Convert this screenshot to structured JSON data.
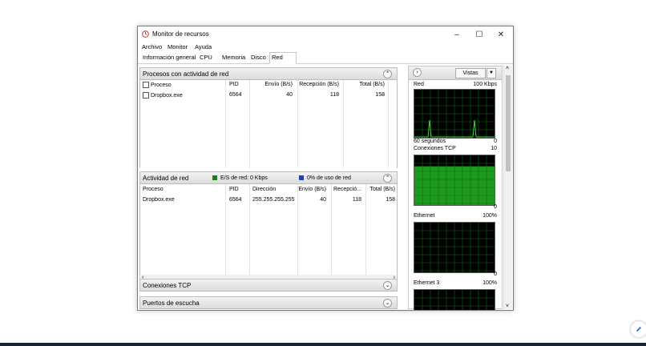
{
  "window": {
    "title": "Monitor de recursos",
    "controls": {
      "minimize": "–",
      "maximize": "☐",
      "close": "✕"
    }
  },
  "menu": [
    "Archivo",
    "Monitor",
    "Ayuda"
  ],
  "tabs": [
    "Información general",
    "CPU",
    "Memoria",
    "Disco",
    "Red"
  ],
  "active_tab": "Red",
  "sections": {
    "procesos": {
      "title": "Procesos con actividad de red",
      "columns": [
        "Proceso",
        "PID",
        "Envío (B/s)",
        "Recepción (B/s)",
        "Total (B/s)"
      ],
      "rows": [
        [
          "Dropbox.exe",
          "6564",
          "40",
          "118",
          "158"
        ]
      ]
    },
    "actividad": {
      "title": "Actividad de red",
      "legend_io": "E/S de red: 0 Kbps",
      "legend_usage": "0% de uso de red",
      "columns": [
        "Proceso",
        "PID",
        "Dirección",
        "Envío (B/s)",
        "Recepció...",
        "Total (B/s)"
      ],
      "rows": [
        [
          "Dropbox.exe",
          "6564",
          "255.255.255.255",
          "40",
          "118",
          "158"
        ]
      ]
    },
    "tcp": {
      "title": "Conexiones TCP"
    },
    "puertos": {
      "title": "Puertos de escucha"
    }
  },
  "right": {
    "views_label": "Vistas",
    "graphs": {
      "red": {
        "title": "Red",
        "max": "100 Kbps",
        "time": "60 segundos",
        "min": "0"
      },
      "tcp": {
        "title": "Conexiones TCP",
        "max": "10",
        "min": "0",
        "level": 0.78
      },
      "ethernet": {
        "title": "Ethernet",
        "max": "100%",
        "min": "0"
      },
      "ethernet3": {
        "title": "Ethernet 3",
        "max": "100%"
      }
    }
  },
  "colors": {
    "graph_background": "#000000",
    "graph_grid": "#0e6b0e",
    "graph_line": "#3ddc3d",
    "tcp_fill": "#22b522",
    "legend_io": "#1e7a1e",
    "legend_usage": "#1f3fbf",
    "edit_fab_icon": "#1e6ad8"
  }
}
